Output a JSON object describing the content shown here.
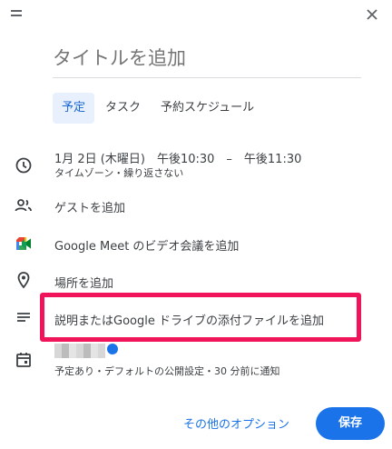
{
  "title_input": {
    "placeholder": "タイトルを追加"
  },
  "tabs": [
    {
      "label": "予定"
    },
    {
      "label": "タスク"
    },
    {
      "label": "予約スケジュール"
    }
  ],
  "datetime": {
    "main": "1月 2日 (木曜日)　午後10:30　–　午後11:30",
    "sub": "タイムゾーン・繰り返さない"
  },
  "guests": {
    "label": "ゲストを追加"
  },
  "meet": {
    "label": "Google Meet のビデオ会議を追加"
  },
  "location": {
    "label": "場所を追加"
  },
  "description": {
    "label": "説明またはGoogle ドライブの添付ファイルを追加"
  },
  "calendar": {
    "sub": "予定あり・デフォルトの公開設定・30 分前に通知"
  },
  "footer": {
    "more_options": "その他のオプション",
    "save": "保存"
  },
  "colors": {
    "accent": "#1a73e8",
    "highlight": "#f0145a",
    "tab_active_bg": "#e8f0fe"
  }
}
